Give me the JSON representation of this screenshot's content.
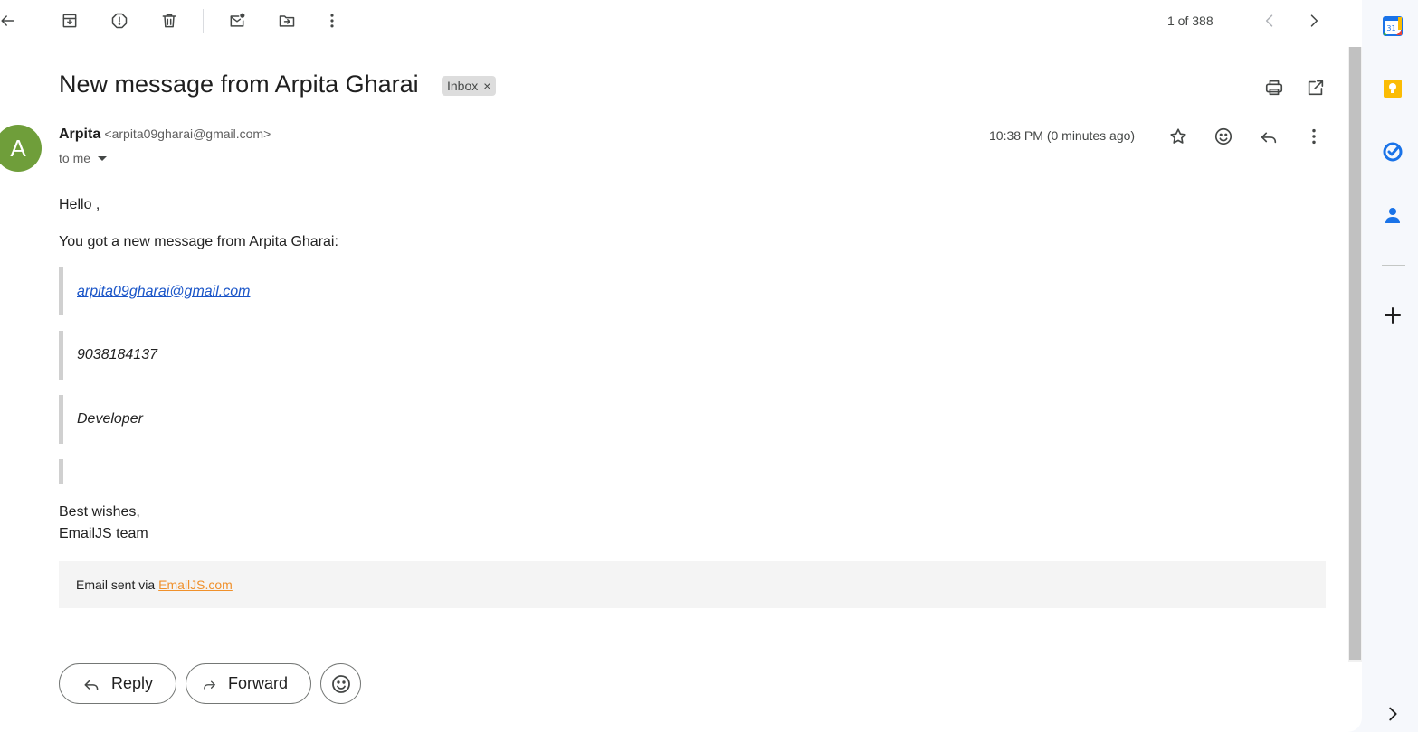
{
  "toolbar": {
    "pager_text": "1 of 388",
    "icons": [
      "back-icon",
      "archive-icon",
      "report-spam-icon",
      "delete-icon",
      "mark-unread-icon",
      "move-to-icon",
      "more-icon",
      "chevron-left-icon",
      "chevron-right-icon"
    ]
  },
  "message": {
    "subject": "New message from Arpita Gharai",
    "label": "Inbox",
    "label_remove": "×",
    "sender_initial": "A",
    "sender_name": "Arpita",
    "sender_email": "<arpita09gharai@gmail.com>",
    "recipient": "to me",
    "time": "10:38 PM (0 minutes ago)"
  },
  "body": {
    "greeting": "Hello ,",
    "intro": "You got a new message from Arpita Gharai:",
    "email_link": "arpita09gharai@gmail.com",
    "phone": "9038184137",
    "role": "Developer",
    "sign_off": "Best wishes,",
    "team": "EmailJS team",
    "footer_prefix": "Email sent via",
    "footer_link": "EmailJS.com"
  },
  "actions": {
    "reply_label": "Reply",
    "forward_label": "Forward"
  },
  "side_panel": {
    "calendar_day": "31",
    "apps": [
      "calendar-icon",
      "keep-icon",
      "tasks-icon",
      "contacts-icon",
      "add-icon",
      "expand-icon"
    ]
  },
  "colors": {
    "avatar": "#6f9e3a",
    "link": "#1a55c8",
    "footer_link": "#f0902b",
    "keep": "#fbbc04",
    "tasks": "#1a73e8",
    "contacts": "#1a73e8"
  }
}
